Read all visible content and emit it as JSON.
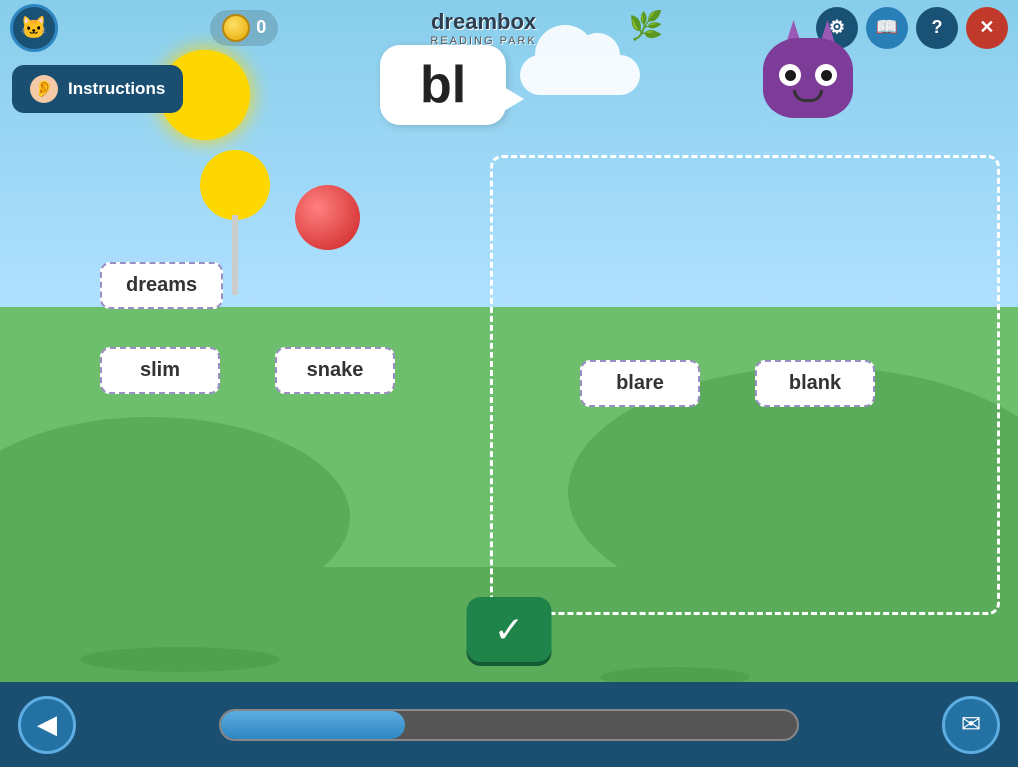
{
  "app": {
    "title": "dreambox",
    "subtitle": "READING PARK",
    "coins": "0"
  },
  "topbar": {
    "settings_label": "⚙",
    "book_label": "📖",
    "help_label": "?",
    "close_label": "✕"
  },
  "instructions": {
    "label": "Instructions"
  },
  "phoneme": {
    "display": "bl"
  },
  "words": {
    "left": [
      {
        "id": "dreams",
        "text": "dreams"
      },
      {
        "id": "slim",
        "text": "slim"
      },
      {
        "id": "snake",
        "text": "snake"
      }
    ],
    "right": [
      {
        "id": "blare",
        "text": "blare"
      },
      {
        "id": "blank",
        "text": "blank"
      }
    ]
  },
  "progress": {
    "percent": 32
  },
  "buttons": {
    "back": "◀",
    "mail": "✉",
    "check": "✓"
  }
}
